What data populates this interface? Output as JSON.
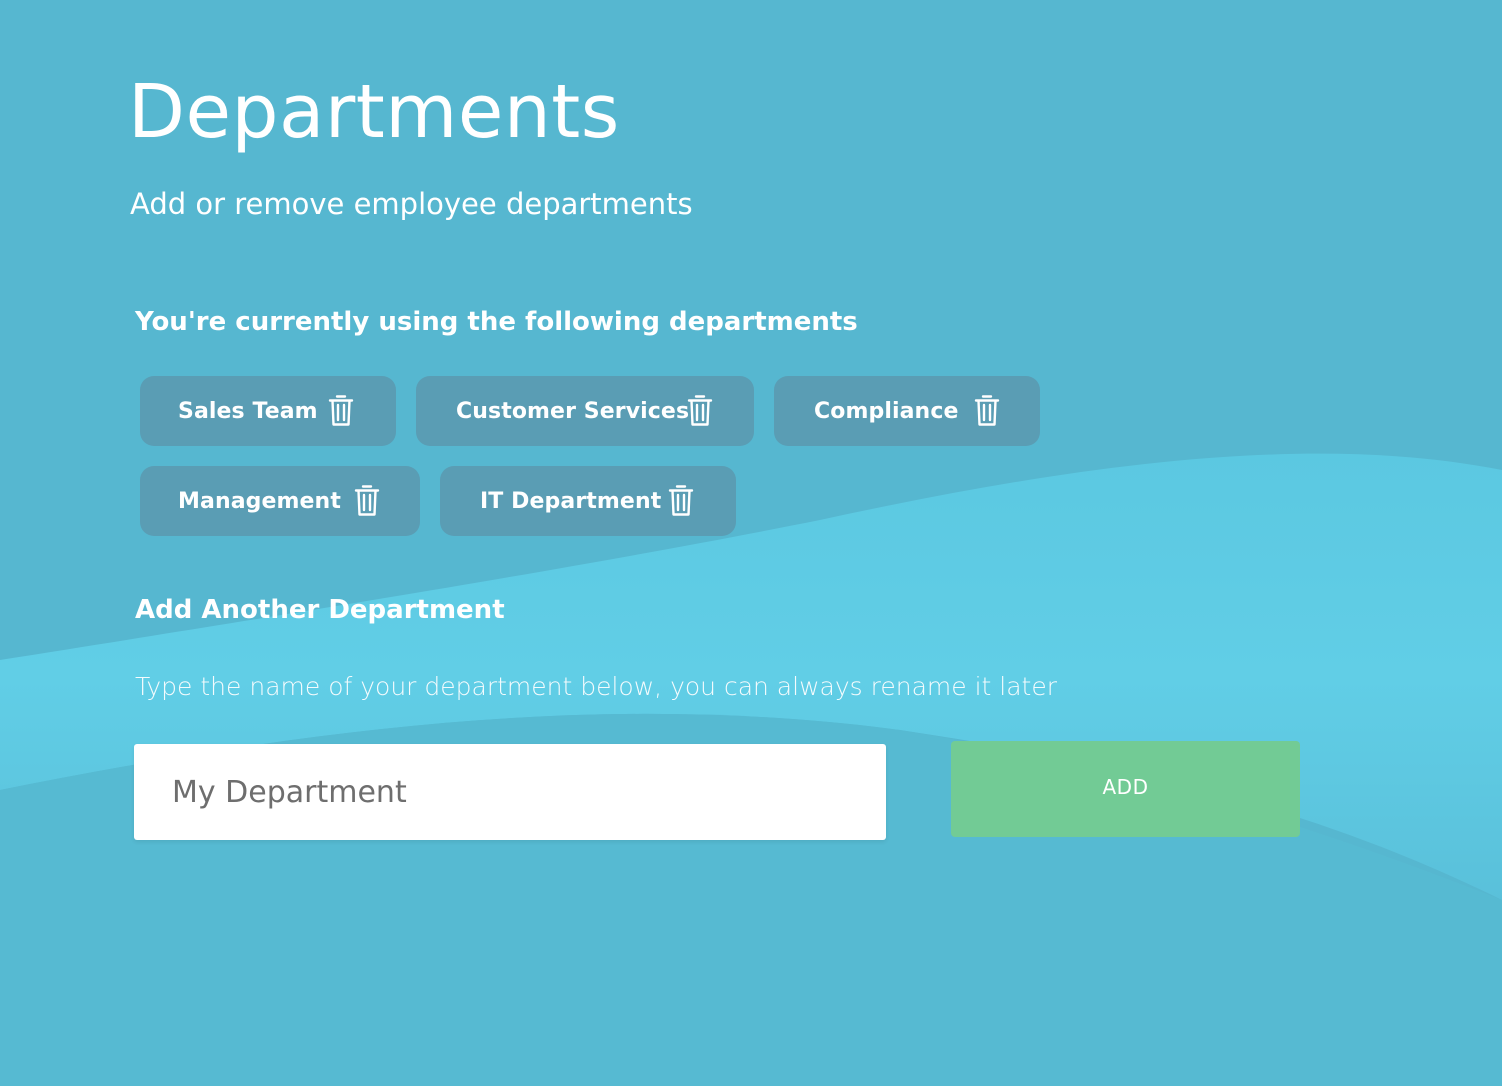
{
  "header": {
    "title": "Departments",
    "subtitle": "Add or remove employee departments"
  },
  "current": {
    "heading": "You're currently using the following departments",
    "delete_icon": "trash-icon",
    "departments": [
      {
        "label": "Sales Team"
      },
      {
        "label": "Customer Services"
      },
      {
        "label": "Compliance"
      },
      {
        "label": "Management"
      },
      {
        "label": "IT Department"
      }
    ]
  },
  "add_department": {
    "heading": "Add Another Department",
    "helper_text": "Type the name of your department below, you can always rename it later",
    "input_value": "",
    "input_placeholder": "My Department",
    "button_label": "ADD"
  },
  "colors": {
    "background": "#56b7d0",
    "background_wave": "#63d0e8",
    "chip": "#5a9db4",
    "add_button": "#72cb95",
    "text": "#ffffff"
  }
}
